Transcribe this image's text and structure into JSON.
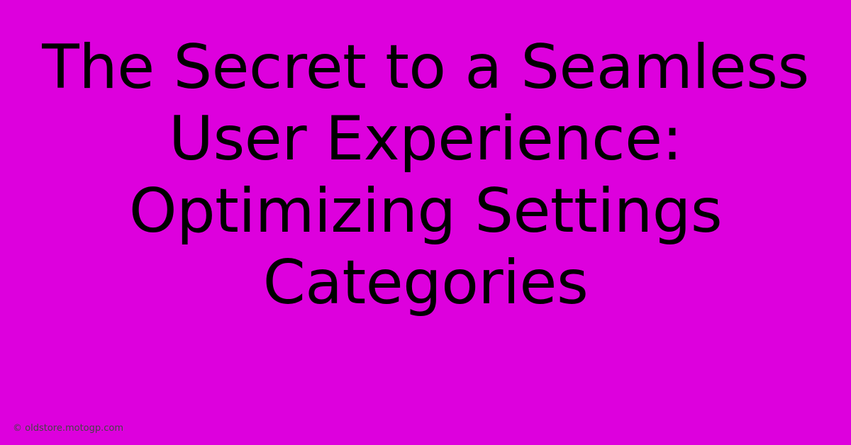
{
  "headline": "The Secret to a Seamless User Experience: Optimizing Settings Categories",
  "attribution": "© oldstore.motogp.com",
  "colors": {
    "background": "#DD00DD",
    "headline_text": "#000000",
    "attribution_text": "#444444"
  }
}
